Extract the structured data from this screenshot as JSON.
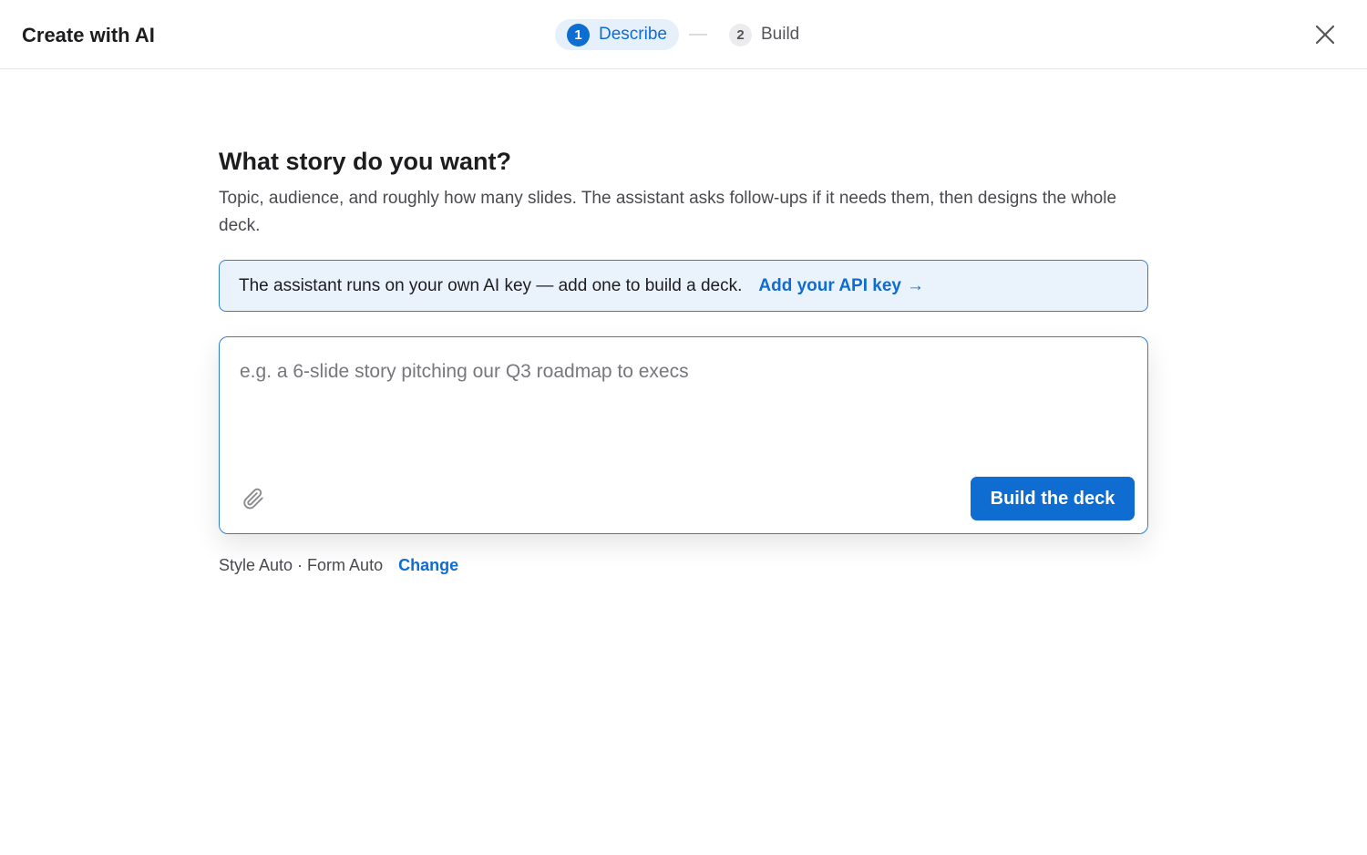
{
  "header": {
    "title": "Create with AI",
    "steps": [
      {
        "number": "1",
        "label": "Describe",
        "state": "active"
      },
      {
        "number": "2",
        "label": "Build",
        "state": "inactive"
      }
    ],
    "close_icon": "close-icon"
  },
  "main": {
    "heading": "What story do you want?",
    "subtext": "Topic, audience, and roughly how many slides. The assistant asks follow-ups if it needs them, then designs the whole deck."
  },
  "notice": {
    "text": "The assistant runs on your own AI key — add one to build a deck.",
    "link_label": "Add your API key",
    "link_arrow": "→"
  },
  "composer": {
    "value": "",
    "placeholder": "e.g. a 6-slide story pitching our Q3 roadmap to execs",
    "attach_icon": "paperclip-icon",
    "submit_label": "Build the deck"
  },
  "style": {
    "summary": "Style Auto · Form Auto",
    "change_label": "Change"
  },
  "colors": {
    "accent": "#0f6cd1",
    "notice_bg": "#eaf2fc",
    "border": "#2f7fd6"
  }
}
